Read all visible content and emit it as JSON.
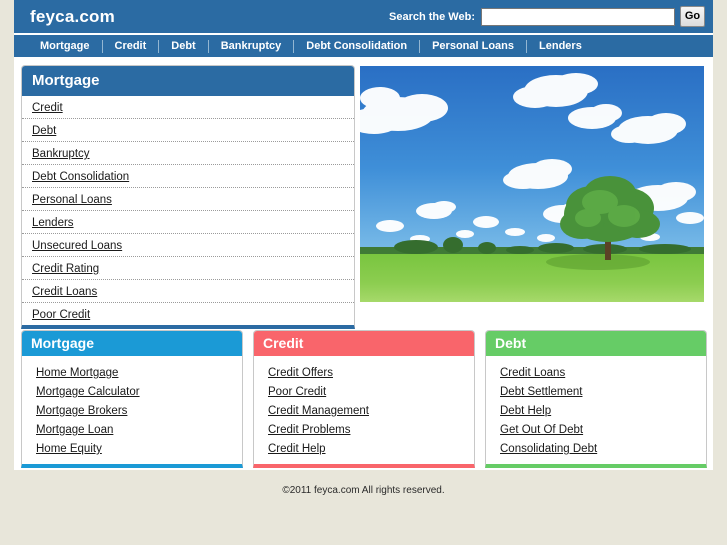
{
  "site": {
    "logo": "feyca.com",
    "footer": "©2011 feyca.com All rights reserved."
  },
  "search": {
    "label": "Search the Web:",
    "value": "",
    "placeholder": "",
    "button": "Go"
  },
  "nav": {
    "items": [
      {
        "label": "Mortgage"
      },
      {
        "label": "Credit"
      },
      {
        "label": "Debt"
      },
      {
        "label": "Bankruptcy"
      },
      {
        "label": "Debt Consolidation"
      },
      {
        "label": "Personal Loans"
      },
      {
        "label": "Lenders"
      }
    ]
  },
  "main_panel": {
    "title": "Mortgage",
    "accent": "#2b6ba3",
    "links": [
      {
        "label": "Credit"
      },
      {
        "label": "Debt"
      },
      {
        "label": "Bankruptcy"
      },
      {
        "label": "Debt Consolidation"
      },
      {
        "label": "Personal Loans"
      },
      {
        "label": "Lenders"
      },
      {
        "label": "Unsecured Loans"
      },
      {
        "label": "Credit Rating"
      },
      {
        "label": "Credit Loans"
      },
      {
        "label": "Poor Credit"
      }
    ]
  },
  "hero": {
    "alt": "Green field with tree under blue sky with clouds",
    "sky_color": "#2f7fd0",
    "grass_color": "#77c03a",
    "cloud_color": "#ffffff",
    "tree_color": "#3f8f30"
  },
  "panels": [
    {
      "title": "Mortgage",
      "accent": "#1b9ad6",
      "links": [
        {
          "label": "Home Mortgage"
        },
        {
          "label": "Mortgage Calculator"
        },
        {
          "label": "Mortgage Brokers"
        },
        {
          "label": "Mortgage Loan"
        },
        {
          "label": "Home Equity"
        }
      ]
    },
    {
      "title": "Credit",
      "accent": "#f9656b",
      "links": [
        {
          "label": "Credit Offers"
        },
        {
          "label": "Poor Credit"
        },
        {
          "label": "Credit Management"
        },
        {
          "label": "Credit Problems"
        },
        {
          "label": "Credit Help"
        }
      ]
    },
    {
      "title": "Debt",
      "accent": "#66cc66",
      "links": [
        {
          "label": "Credit Loans"
        },
        {
          "label": "Debt Settlement"
        },
        {
          "label": "Debt Help"
        },
        {
          "label": "Get Out Of Debt"
        },
        {
          "label": "Consolidating Debt"
        }
      ]
    }
  ]
}
